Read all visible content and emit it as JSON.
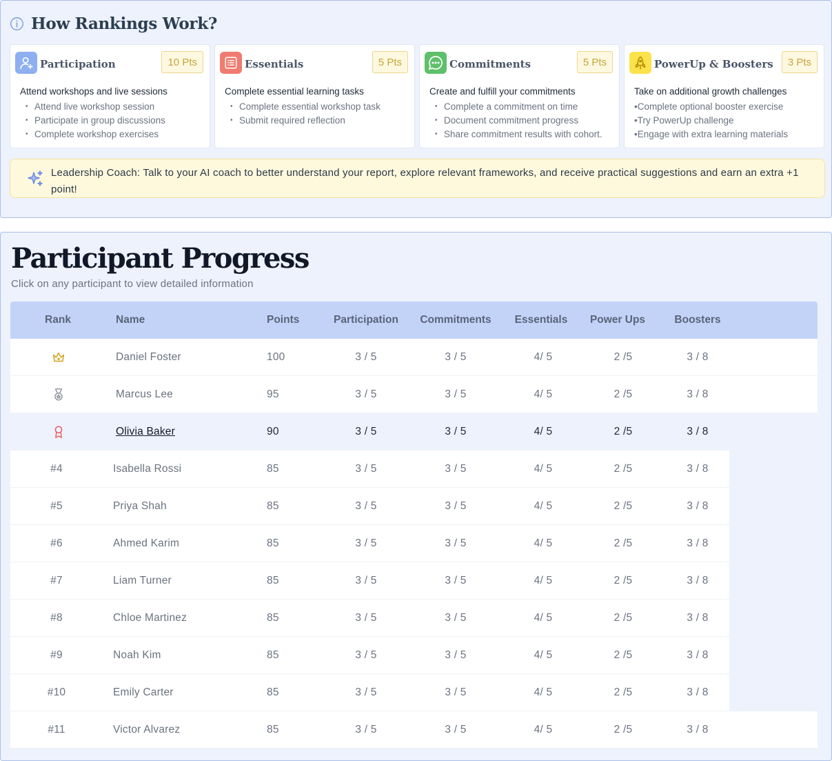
{
  "rankings": {
    "title": "How Rankings Work?",
    "cards": [
      {
        "title": "Participation",
        "points": "10 Pts",
        "icon": "user-icon",
        "icon_color": "#8eaff0",
        "lead": "Attend workshops and live sessions",
        "items": [
          "Attend live workshop session",
          "Participate in group discussions",
          "Complete workshop exercises"
        ]
      },
      {
        "title": "Essentials",
        "points": "5 Pts",
        "icon": "list-icon",
        "icon_color": "#f07b70",
        "lead": "Complete essential learning tasks",
        "items": [
          "Complete essential workshop task",
          "Submit required reflection"
        ]
      },
      {
        "title": "Commitments",
        "points": "5 Pts",
        "icon": "chat-bubble-icon",
        "icon_color": "#5fc06c",
        "lead": "Create and fulfill your commitments",
        "items": [
          "Complete a commitment on time",
          "Document commitment progress",
          "Share commitment results with cohort."
        ]
      },
      {
        "title": "PowerUp & Boosters",
        "points": "3 Pts",
        "icon": "rocket-icon",
        "icon_color": "#fbe24a",
        "lead": "Take on additional growth challenges",
        "items": [
          "•Complete optional booster exercise",
          "•Try PowerUp challenge",
          "•Engage with extra learning materials"
        ]
      }
    ],
    "coach_text": "Leadership Coach: Talk to your AI coach to better understand your report, explore relevant frameworks, and receive practical suggestions and earn an extra +1 point!"
  },
  "progress": {
    "title": "Participant Progress",
    "subtitle": "Click on any participant to view detailed information",
    "columns": [
      "Rank",
      "Name",
      "Points",
      "Participation",
      "Commitments",
      "Essentials",
      "Power Ups",
      "Boosters"
    ],
    "rows": [
      {
        "rank": "",
        "rank_icon": "crown-icon",
        "name": "Daniel Foster",
        "points": "100",
        "participation": "3 / 5",
        "commitments": "3 / 5",
        "essentials": "4/ 5",
        "power_ups": "2 /5",
        "boosters": "3 / 8"
      },
      {
        "rank": "",
        "rank_icon": "medal-icon",
        "name": "Marcus Lee",
        "points": "95",
        "participation": "3 / 5",
        "commitments": "3 / 5",
        "essentials": "4/ 5",
        "power_ups": "2 /5",
        "boosters": "3 / 8"
      },
      {
        "rank": "",
        "rank_icon": "award-ribbon-icon",
        "name": "Olivia Baker",
        "points": "90",
        "participation": "3 / 5",
        "commitments": "3 / 5",
        "essentials": "4/ 5",
        "power_ups": "2 /5",
        "boosters": "3 / 8",
        "selected": true
      },
      {
        "rank": "#4",
        "name": "Isabella Rossi",
        "points": "85",
        "participation": "3 / 5",
        "commitments": "3 / 5",
        "essentials": "4/ 5",
        "power_ups": "2 /5",
        "boosters": "3 / 8"
      },
      {
        "rank": "#5",
        "name": "Priya Shah",
        "points": "85",
        "participation": "3 / 5",
        "commitments": "3 / 5",
        "essentials": "4/ 5",
        "power_ups": "2 /5",
        "boosters": "3 / 8"
      },
      {
        "rank": "#6",
        "name": "Ahmed Karim",
        "points": "85",
        "participation": "3 / 5",
        "commitments": "3 / 5",
        "essentials": "4/ 5",
        "power_ups": "2 /5",
        "boosters": "3 / 8"
      },
      {
        "rank": "#7",
        "name": "Liam Turner",
        "points": "85",
        "participation": "3 / 5",
        "commitments": "3 / 5",
        "essentials": "4/ 5",
        "power_ups": "2 /5",
        "boosters": "3 / 8"
      },
      {
        "rank": "#8",
        "name": "Chloe Martinez",
        "points": "85",
        "participation": "3 / 5",
        "commitments": "3 / 5",
        "essentials": "4/ 5",
        "power_ups": "2 /5",
        "boosters": "3 / 8"
      },
      {
        "rank": "#9",
        "name": "Noah Kim",
        "points": "85",
        "participation": "3 / 5",
        "commitments": "3 / 5",
        "essentials": "4/ 5",
        "power_ups": "2 /5",
        "boosters": "3 / 8"
      },
      {
        "rank": "#10",
        "name": "Emily Carter",
        "points": "85",
        "participation": "3 / 5",
        "commitments": "3 / 5",
        "essentials": "4/ 5",
        "power_ups": "2 /5",
        "boosters": "3 / 8"
      },
      {
        "rank": "#11",
        "name": "Victor Alvarez",
        "points": "85",
        "participation": "3 / 5",
        "commitments": "3 / 5",
        "essentials": "4/ 5",
        "power_ups": "2 /5",
        "boosters": "3 / 8"
      }
    ]
  },
  "colors": {
    "panel_bg": "#edf2fd",
    "header_bg": "#c3d3f8",
    "points_badge": "#c7a53d",
    "crown": "#d4a017",
    "ribbon": "#e85d5d"
  }
}
